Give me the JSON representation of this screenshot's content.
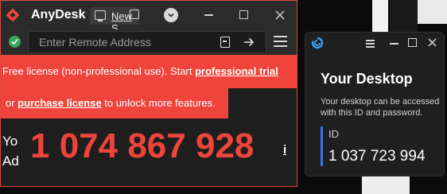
{
  "main_window": {
    "app_title": "AnyDesk",
    "tab_label": "New S",
    "address_placeholder": "Enter Remote Address",
    "banner_line1_prefix": "Free license (non-professional use). Start ",
    "banner_line1_link": "professional trial",
    "banner_line2_prefix": "or ",
    "banner_line2_link": "purchase license",
    "banner_line2_suffix": " to unlock more features.",
    "partial_word_1": "Yo",
    "partial_word_2": "Ad",
    "desk_id": "1 074 867 928",
    "info_glyph": "i",
    "icons": {
      "logo": "anydesk-logo-icon",
      "tab": "monitor-icon",
      "tab_close": "tab-close-icon",
      "menu": "more-dots-icon",
      "minimize": "minimize-icon",
      "maximize": "maximize-icon",
      "close": "close-icon",
      "status": "check-icon",
      "file": "file-transfer-icon",
      "connect": "arrow-right-icon",
      "hamburger": "hamburger-menu-icon"
    }
  },
  "side_window": {
    "heading": "Your Desktop",
    "description": "Your desktop can be accessed with this ID and password.",
    "id_label": "ID",
    "id_value": "1 037 723 994",
    "icons": {
      "logo": "app-logo-icon",
      "menu": "hamburger-menu-icon",
      "minimize": "minimize-icon",
      "maximize": "maximize-icon",
      "close": "close-icon"
    }
  },
  "colors": {
    "accent_red": "#ef443b",
    "status_green": "#3ba55c",
    "id_bar_blue": "#3b74f0",
    "window_bg": "#1e1e1e",
    "titlebar_bg": "#2b2b2b"
  }
}
